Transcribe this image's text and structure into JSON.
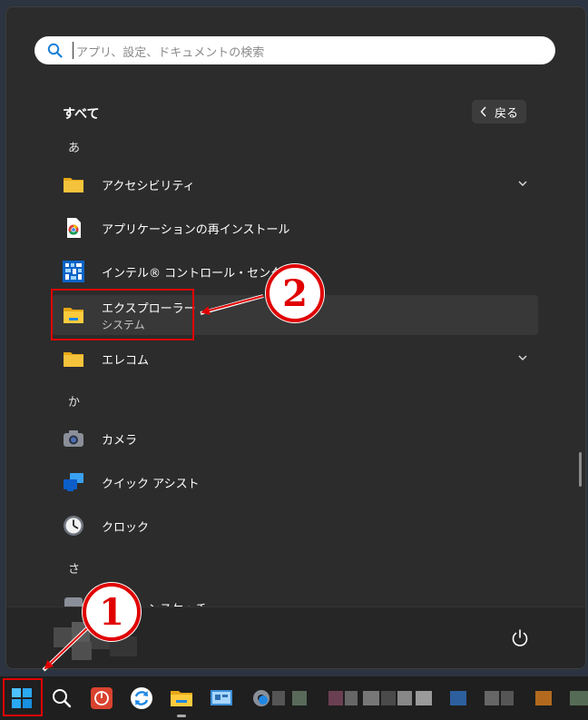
{
  "search": {
    "placeholder": "アプリ、設定、ドキュメントの検索"
  },
  "all_apps": {
    "title": "すべて",
    "back_label": "戻る"
  },
  "groups": [
    {
      "letter": "あ"
    },
    {
      "letter": "か"
    },
    {
      "letter": "さ"
    }
  ],
  "apps": [
    {
      "label": "アクセシビリティ",
      "icon": "folder-icon",
      "expandable": true
    },
    {
      "label": "アプリケーションの再インストール",
      "icon": "reinstall-app-icon"
    },
    {
      "label": "インテル® コントロール・センター",
      "icon": "intel-control-center-icon"
    },
    {
      "label": "エクスプローラー",
      "sub": "システム",
      "icon": "file-explorer-icon",
      "selected": true
    },
    {
      "label": "エレコム",
      "icon": "folder-icon",
      "expandable": true
    },
    {
      "label": "カメラ",
      "icon": "camera-icon"
    },
    {
      "label": "クイック アシスト",
      "icon": "quick-assist-icon"
    },
    {
      "label": "クロック",
      "icon": "clock-icon"
    },
    {
      "label": "スクリーンスケッチ",
      "icon": "app-icon",
      "partially_hidden": true
    }
  ],
  "annotations": {
    "step1": "①",
    "step2": "②"
  },
  "colors": {
    "highlight": "#e00000",
    "menu_bg": "#2c2c2c",
    "folder": "#f5c33b"
  }
}
